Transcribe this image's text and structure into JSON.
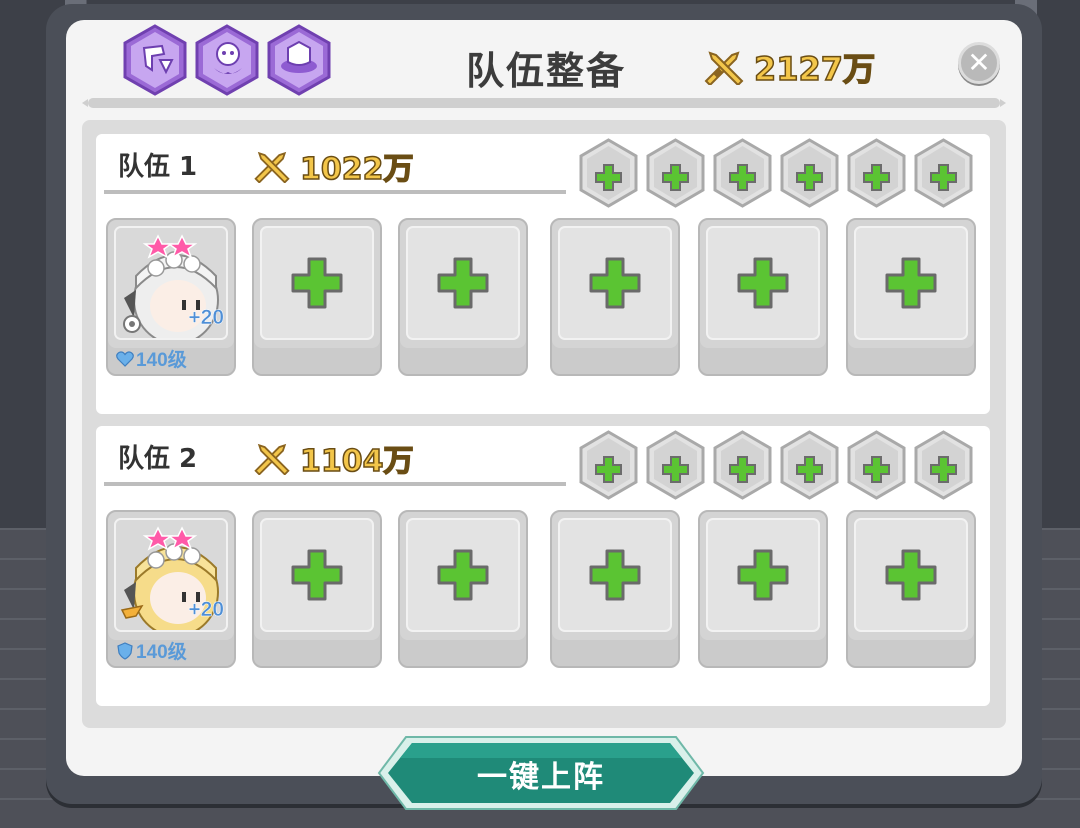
{
  "header": {
    "title": "队伍整备",
    "total_power": "2127万",
    "tab_icons": [
      "shield-arrow-icon",
      "ghost-swirl-icon",
      "portal-swirl-icon"
    ],
    "close_symbol": "✕"
  },
  "teams": [
    {
      "name": "队伍 1",
      "power": "1022万",
      "hero": {
        "bonus": "+20",
        "level": "140级",
        "level_icon": "heart-icon",
        "element_icon": "gear-icon",
        "hair": "silver"
      },
      "empty_slots": 5,
      "rune_slots": 6
    },
    {
      "name": "队伍 2",
      "power": "1104万",
      "hero": {
        "bonus": "+20",
        "level": "140级",
        "level_icon": "shield-icon",
        "element_icon": "wing-icon",
        "hair": "blonde"
      },
      "empty_slots": 5,
      "rune_slots": 6
    }
  ],
  "deploy_button": {
    "label": "一键上阵"
  },
  "colors": {
    "accent_green": "#5bc433",
    "power_gold": "#f3c64a",
    "button_teal": "#1f8a78",
    "level_blue": "#5a9ad8"
  }
}
